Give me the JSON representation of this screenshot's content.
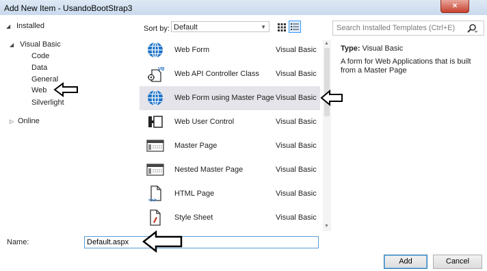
{
  "window": {
    "title": "Add New Item - UsandoBootStrap3",
    "close_glyph": "×"
  },
  "tree": {
    "installed": "Installed",
    "visual_basic": "Visual Basic",
    "children": [
      "Code",
      "Data",
      "General",
      "Web",
      "Silverlight"
    ],
    "online": "Online",
    "selected": "Web"
  },
  "toolbar": {
    "sort_by_label": "Sort by:",
    "sort_value": "Default",
    "search_placeholder": "Search Installed Templates (Ctrl+E)"
  },
  "templates": [
    {
      "name": "Web Form",
      "language": "Visual Basic",
      "icon": "globe-icon"
    },
    {
      "name": "Web API Controller Class",
      "language": "Visual Basic",
      "icon": "vb-class-icon"
    },
    {
      "name": "Web Form using Master Page",
      "language": "Visual Basic",
      "icon": "globe-icon",
      "selected": true
    },
    {
      "name": "Web User Control",
      "language": "Visual Basic",
      "icon": "user-control-icon"
    },
    {
      "name": "Master Page",
      "language": "Visual Basic",
      "icon": "master-page-icon"
    },
    {
      "name": "Nested Master Page",
      "language": "Visual Basic",
      "icon": "master-page-icon"
    },
    {
      "name": "HTML Page",
      "language": "Visual Basic",
      "icon": "html-page-icon"
    },
    {
      "name": "Style Sheet",
      "language": "Visual Basic",
      "icon": "style-sheet-icon"
    }
  ],
  "details": {
    "type_label": "Type:",
    "type_value": "Visual Basic",
    "description": "A form for Web Applications that is built from a Master Page"
  },
  "name_field": {
    "label": "Name:",
    "value": "Default.aspx"
  },
  "buttons": {
    "add": "Add",
    "cancel": "Cancel"
  },
  "colors": {
    "selection": "#e4e4ea",
    "accent": "#3399ff",
    "globe": "#1e73c8"
  }
}
